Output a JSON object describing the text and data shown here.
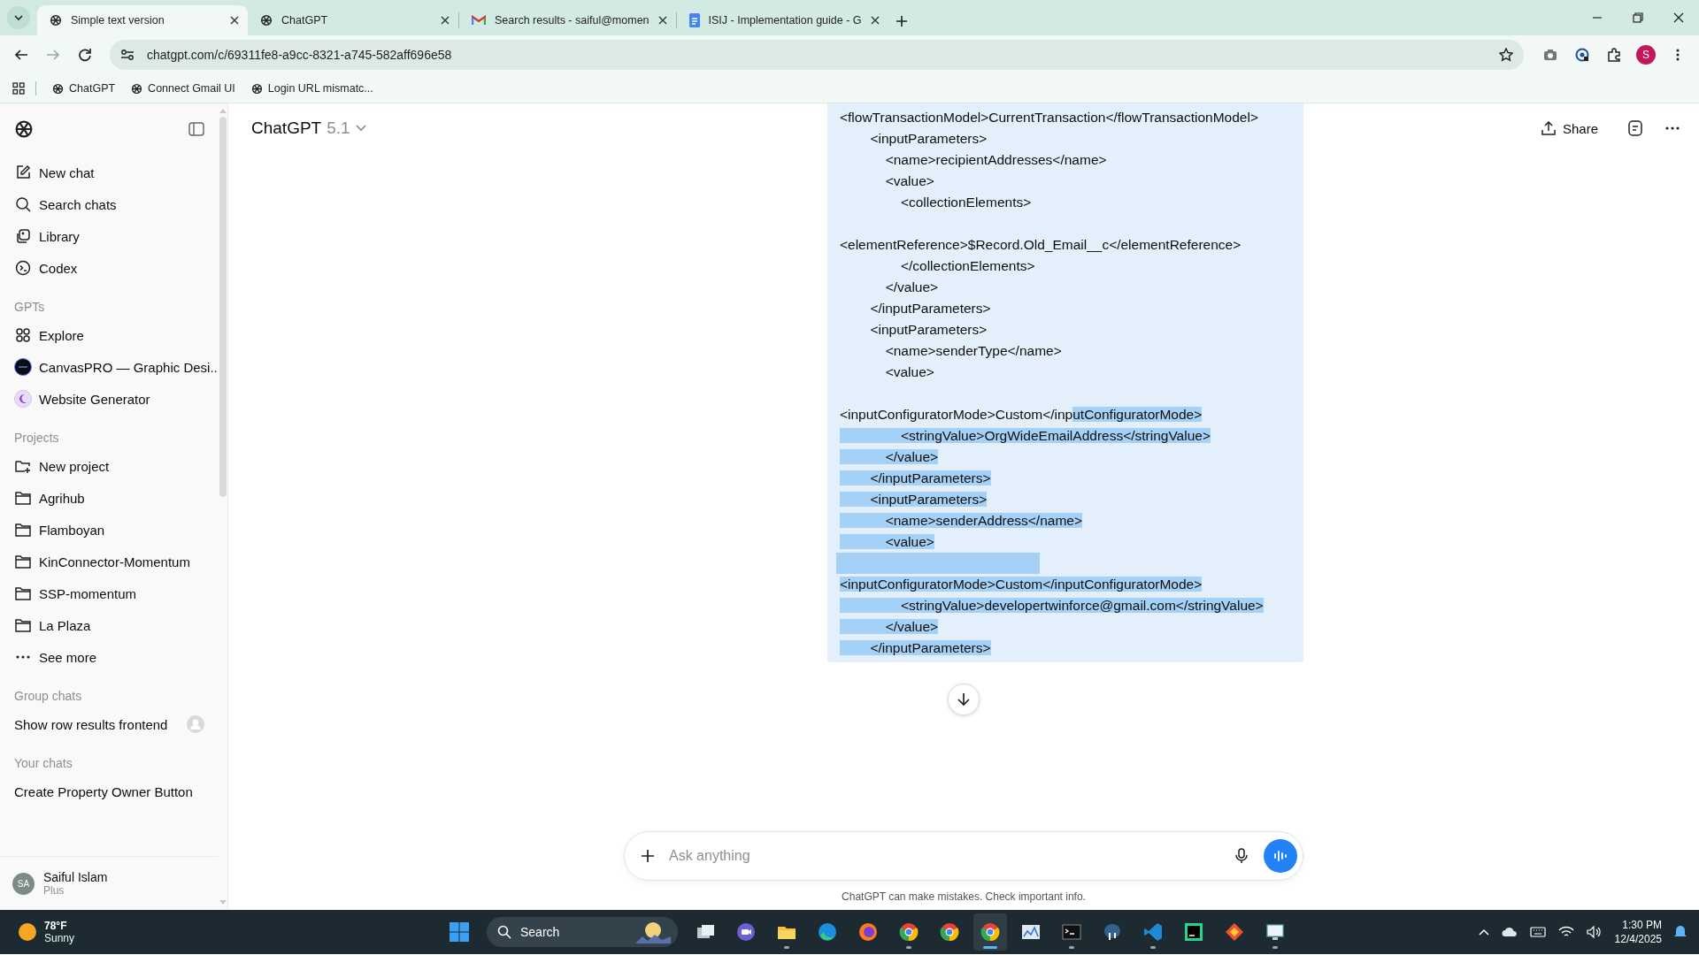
{
  "browser": {
    "tabs": [
      {
        "title": "Simple text version",
        "selected": true
      },
      {
        "title": "ChatGPT",
        "selected": false
      },
      {
        "title": "Search results - saiful@momen",
        "selected": false
      },
      {
        "title": "ISIJ - Implementation guide - G",
        "selected": false
      }
    ],
    "url": "chatgpt.com/c/69311fe8-a9cc-8321-a745-582aff696e58",
    "profile_initial": "S",
    "bookmarks": [
      "ChatGPT",
      "Connect Gmail UI",
      "Login URL mismatc..."
    ]
  },
  "sidebar": {
    "nav": [
      {
        "label": "New chat",
        "kind": "new-chat"
      },
      {
        "label": "Search chats",
        "kind": "search"
      },
      {
        "label": "Library",
        "kind": "library"
      },
      {
        "label": "Codex",
        "kind": "codex"
      }
    ],
    "sections": [
      {
        "heading": "GPTs",
        "items": [
          {
            "label": "Explore",
            "kind": "explore"
          },
          {
            "label": "CanvasPRO — Graphic Desi...",
            "kind": "gpt-dark"
          },
          {
            "label": "Website Generator",
            "kind": "gpt-light"
          }
        ]
      },
      {
        "heading": "Projects",
        "items": [
          {
            "label": "New project",
            "kind": "new-project"
          },
          {
            "label": "Agrihub",
            "kind": "project"
          },
          {
            "label": "Flamboyan",
            "kind": "project"
          },
          {
            "label": "KinConnector-Momentum",
            "kind": "project"
          },
          {
            "label": "SSP-momentum",
            "kind": "project"
          },
          {
            "label": "La Plaza",
            "kind": "project"
          },
          {
            "label": "See more",
            "kind": "more"
          }
        ]
      },
      {
        "heading": "Group chats",
        "items": [
          {
            "label": "Show row results frontend",
            "kind": "group"
          }
        ]
      },
      {
        "heading": "Your chats",
        "items": [
          {
            "label": "Create Property Owner Button",
            "kind": "chat"
          }
        ]
      }
    ],
    "user": {
      "initials": "SA",
      "name": "Saiful Islam",
      "plan": "Plus"
    }
  },
  "header": {
    "model": "ChatGPT",
    "version": "5.1",
    "share": "Share"
  },
  "message": {
    "lines": [
      {
        "kind": "code",
        "segments": [
          {
            "text": "<flowTransactionModel>CurrentTransaction</flowTransactionModel>",
            "selected": false
          }
        ]
      },
      {
        "kind": "code",
        "segments": [
          {
            "text": "        <inputParameters>",
            "selected": false
          }
        ]
      },
      {
        "kind": "code",
        "segments": [
          {
            "text": "            <name>recipientAddresses</name>",
            "selected": false
          }
        ]
      },
      {
        "kind": "code",
        "segments": [
          {
            "text": "            <value>",
            "selected": false
          }
        ]
      },
      {
        "kind": "code",
        "segments": [
          {
            "text": "                <collectionElements>",
            "selected": false
          }
        ]
      },
      {
        "kind": "blank",
        "selected": false
      },
      {
        "kind": "code",
        "segments": [
          {
            "text": "<elementReference>$Record.Old_Email__c</elementReference>",
            "selected": false
          }
        ]
      },
      {
        "kind": "code",
        "segments": [
          {
            "text": "                </collectionElements>",
            "selected": false
          }
        ]
      },
      {
        "kind": "code",
        "segments": [
          {
            "text": "            </value>",
            "selected": false
          }
        ]
      },
      {
        "kind": "code",
        "segments": [
          {
            "text": "        </inputParameters>",
            "selected": false
          }
        ]
      },
      {
        "kind": "code",
        "segments": [
          {
            "text": "        <inputParameters>",
            "selected": false
          }
        ]
      },
      {
        "kind": "code",
        "segments": [
          {
            "text": "            <name>senderType</name>",
            "selected": false
          }
        ]
      },
      {
        "kind": "code",
        "segments": [
          {
            "text": "            <value>",
            "selected": false
          }
        ]
      },
      {
        "kind": "blank",
        "selected": false
      },
      {
        "kind": "code",
        "segments": [
          {
            "text": "<inputConfiguratorMode>Custom</inp",
            "selected": false
          },
          {
            "text": "utConfiguratorMode>",
            "selected": true
          }
        ]
      },
      {
        "kind": "code",
        "segments": [
          {
            "text": "                <stringValue>OrgWideEmailAddress</stringValue>",
            "selected": true
          }
        ]
      },
      {
        "kind": "code",
        "segments": [
          {
            "text": "            </value>",
            "selected": true
          }
        ]
      },
      {
        "kind": "code",
        "segments": [
          {
            "text": "        </inputParameters>",
            "selected": true
          }
        ]
      },
      {
        "kind": "code",
        "segments": [
          {
            "text": "        <inputParameters>",
            "selected": true
          }
        ]
      },
      {
        "kind": "code",
        "segments": [
          {
            "text": "            <name>senderAddress</name>",
            "selected": true
          }
        ]
      },
      {
        "kind": "code",
        "segments": [
          {
            "text": "            <value>",
            "selected": true
          }
        ]
      },
      {
        "kind": "blank",
        "selected": true
      },
      {
        "kind": "code",
        "segments": [
          {
            "text": "<inputConfiguratorMode>Custom</inputConfiguratorMode>",
            "selected": true
          }
        ]
      },
      {
        "kind": "code",
        "segments": [
          {
            "text": "                <stringValue>developertwinforce@gmail.com</stringValue>",
            "selected": true
          }
        ]
      },
      {
        "kind": "code",
        "segments": [
          {
            "text": "            </value>",
            "selected": true
          }
        ]
      },
      {
        "kind": "code",
        "segments": [
          {
            "text": "        </inputParameters>",
            "selected": true
          }
        ]
      }
    ]
  },
  "composer": {
    "placeholder": "Ask anything",
    "disclaimer": "ChatGPT can make mistakes. Check important info."
  },
  "taskbar": {
    "weather": {
      "temp": "78°F",
      "condition": "Sunny"
    },
    "search": "Search",
    "apps": [
      {
        "running": false,
        "selected": false
      },
      {
        "running": false,
        "selected": false
      },
      {
        "running": true,
        "selected": false
      },
      {
        "running": false,
        "selected": false
      },
      {
        "running": false,
        "selected": false
      },
      {
        "running": true,
        "selected": false
      },
      {
        "running": false,
        "selected": false
      },
      {
        "running": true,
        "selected": true
      },
      {
        "running": false,
        "selected": false
      },
      {
        "running": true,
        "selected": false
      },
      {
        "running": false,
        "selected": false
      },
      {
        "running": true,
        "selected": false
      },
      {
        "running": false,
        "selected": false
      },
      {
        "running": false,
        "selected": false
      },
      {
        "running": true,
        "selected": false
      }
    ],
    "time": "1:30 PM",
    "date": "12/4/2025"
  }
}
